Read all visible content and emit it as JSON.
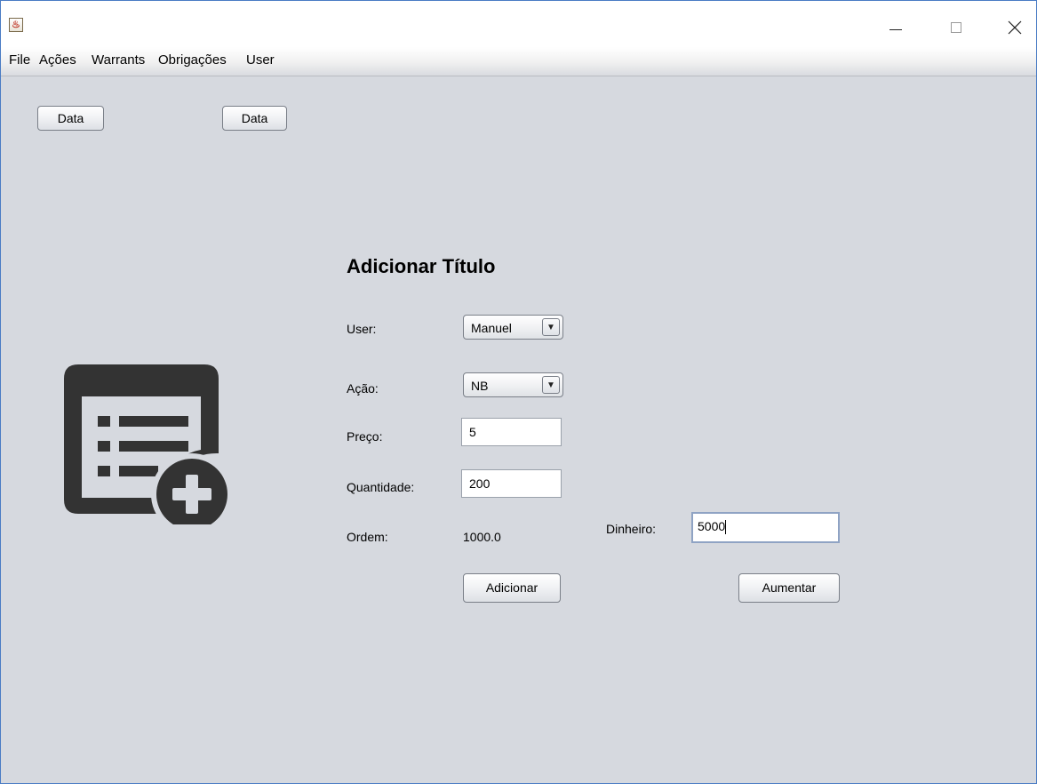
{
  "menubar": {
    "items": [
      "File",
      "Ações",
      "Warrants",
      "Obrigações",
      "User"
    ]
  },
  "toolbar": {
    "data_button_1": "Data",
    "data_button_2": "Data"
  },
  "form": {
    "title": "Adicionar Título",
    "user_label": "User:",
    "user_value": "Manuel",
    "acao_label": "Ação:",
    "acao_value": "NB",
    "preco_label": "Preço:",
    "preco_value": "5",
    "quantidade_label": "Quantidade:",
    "quantidade_value": "200",
    "ordem_label": "Ordem:",
    "ordem_value": "1000.0",
    "dinheiro_label": "Dinheiro:",
    "dinheiro_value": "5000",
    "adicionar_button": "Adicionar",
    "aumentar_button": "Aumentar"
  },
  "icons": {
    "app": "java-app-icon",
    "main": "add-list-document-icon",
    "combo_arrow": "▼"
  },
  "colors": {
    "background": "#d6d9df",
    "icon_dark": "#333333",
    "window_border": "#4a7cc4"
  }
}
